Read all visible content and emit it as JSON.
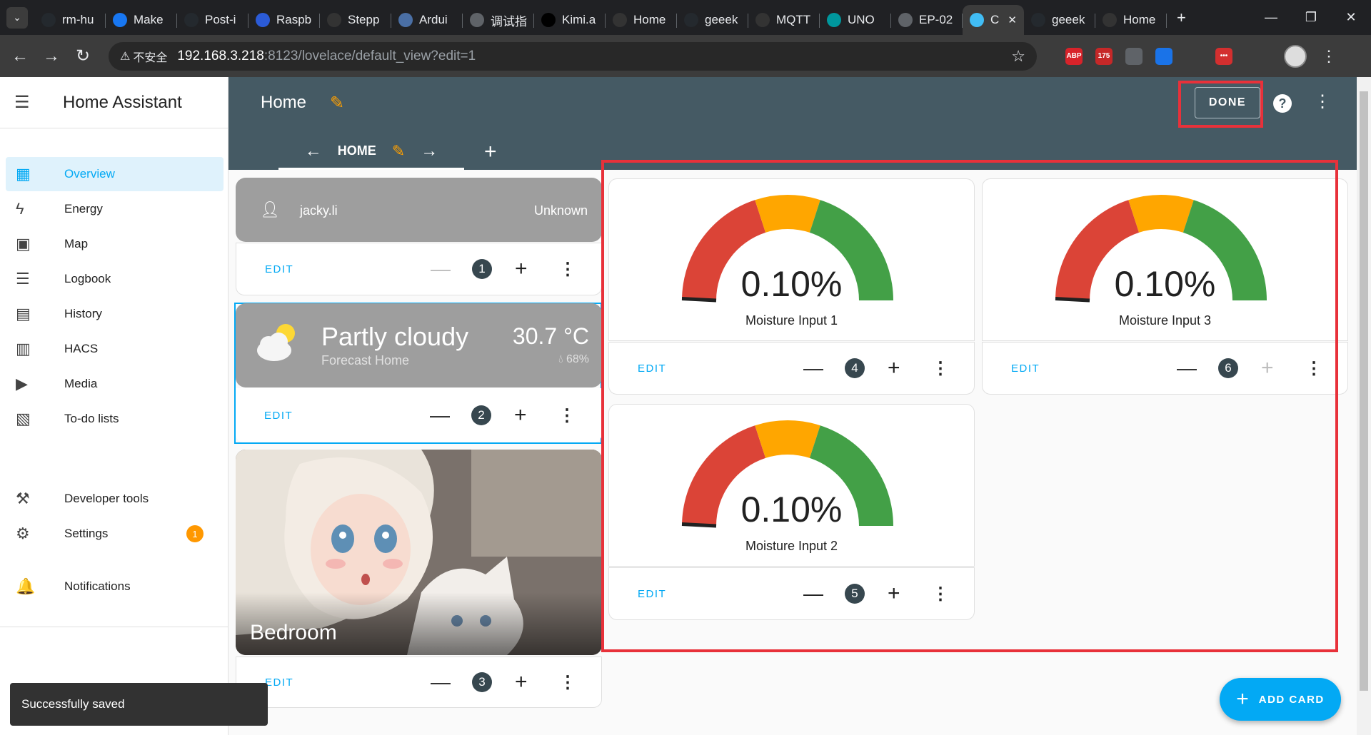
{
  "browser": {
    "tabs": [
      {
        "label": "rm-hu",
        "icon_color": "#24292e",
        "icon": "github-icon"
      },
      {
        "label": "Make",
        "icon_color": "#1877f2",
        "icon": "facebook-icon"
      },
      {
        "label": "Post-i",
        "icon_color": "#24292e",
        "icon": "github-icon"
      },
      {
        "label": "Raspb",
        "icon_color": "#2b5bd7",
        "icon": "raspberry-icon"
      },
      {
        "label": "Stepp",
        "icon_color": "#333333",
        "icon": "page-icon"
      },
      {
        "label": "Ardui",
        "icon_color": "#4a6fa5",
        "icon": "robot-icon"
      },
      {
        "label": "调试指",
        "icon_color": "#5f6368",
        "icon": "globe-icon"
      },
      {
        "label": "Kimi.a",
        "icon_color": "#000000",
        "icon": "kimi-icon"
      },
      {
        "label": "Home",
        "icon_color": "#333333",
        "icon": "page-icon"
      },
      {
        "label": "geeek",
        "icon_color": "#24292e",
        "icon": "github-icon"
      },
      {
        "label": "MQTT",
        "icon_color": "#333333",
        "icon": "page-icon"
      },
      {
        "label": "UNO",
        "icon_color": "#00979d",
        "icon": "arduino-icon"
      },
      {
        "label": "EP-02",
        "icon_color": "#5f6368",
        "icon": "globe-icon"
      },
      {
        "label": "C",
        "icon_color": "#41bdf5",
        "icon": "home-assistant-icon",
        "active": true
      },
      {
        "label": "geeek",
        "icon_color": "#24292e",
        "icon": "github-icon"
      },
      {
        "label": "Home",
        "icon_color": "#333333",
        "icon": "page-icon"
      }
    ],
    "new_tab": "+",
    "insecure_label": "不安全",
    "url_host": "192.168.3.218",
    "url_path": ":8123/lovelace/default_view?edit=1",
    "extensions": [
      {
        "label": "ABP",
        "color": "#d8232a"
      },
      {
        "label": "175",
        "color": "#c62828"
      },
      {
        "label": "",
        "color": "#5f6368"
      },
      {
        "label": "",
        "color": "#1a73e8"
      },
      {
        "label": "",
        "color": "#3c3c3c"
      },
      {
        "label": "•••",
        "color": "#d32f2f"
      },
      {
        "label": "",
        "color": "#3c3c3c"
      }
    ]
  },
  "sidebar": {
    "title": "Home Assistant",
    "items": [
      {
        "label": "Overview",
        "icon": "▦",
        "name": "overview",
        "selected": true
      },
      {
        "label": "Energy",
        "icon": "ϟ",
        "name": "energy"
      },
      {
        "label": "Map",
        "icon": "▣",
        "name": "map"
      },
      {
        "label": "Logbook",
        "icon": "☰",
        "name": "logbook"
      },
      {
        "label": "History",
        "icon": "▤",
        "name": "history"
      },
      {
        "label": "HACS",
        "icon": "▥",
        "name": "hacs"
      },
      {
        "label": "Media",
        "icon": "▶",
        "name": "media"
      },
      {
        "label": "To-do lists",
        "icon": "▧",
        "name": "todo"
      },
      {
        "label": "Developer tools",
        "icon": "⚒",
        "name": "developer-tools"
      },
      {
        "label": "Settings",
        "icon": "⚙",
        "name": "settings",
        "badge": "1"
      },
      {
        "label": "Notifications",
        "icon": "🔔",
        "name": "notifications"
      }
    ]
  },
  "header": {
    "title": "Home",
    "done_label": "DONE",
    "help": "?",
    "view_tab_label": "HOME"
  },
  "cards": {
    "edit_label": "EDIT",
    "person": {
      "name": "jacky.li",
      "state": "Unknown",
      "position": "1"
    },
    "weather": {
      "condition": "Partly cloudy",
      "name": "Forecast Home",
      "temperature": "30.7 °C",
      "humidity": "68%",
      "position": "2"
    },
    "area": {
      "name": "Bedroom",
      "position": "3"
    },
    "gauges": [
      {
        "value": "0.10%",
        "name": "Moisture Input 1",
        "position": "4",
        "level": 0.001
      },
      {
        "value": "0.10%",
        "name": "Moisture Input 3",
        "position": "6",
        "level": 0.001
      },
      {
        "value": "0.10%",
        "name": "Moisture Input 2",
        "position": "5",
        "level": 0.001
      }
    ],
    "gauge_colors": {
      "red": "#db4437",
      "yellow": "#ffa600",
      "green": "#43a047"
    }
  },
  "add_card_label": "ADD CARD",
  "toast": "Successfully saved"
}
